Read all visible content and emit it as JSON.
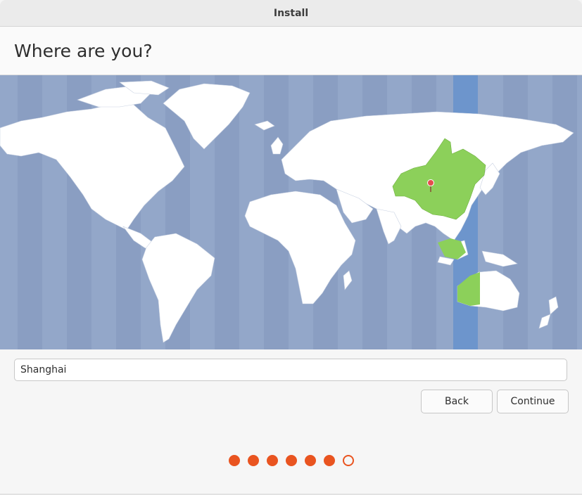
{
  "window": {
    "title": "Install"
  },
  "page": {
    "title": "Where are you?"
  },
  "map": {
    "selected_region": "China / Asia/Shanghai",
    "colors": {
      "ocean": "#93a7c9",
      "land": "#ffffff",
      "selected_land": "#8cd05a",
      "timezone_highlight": "#6d95cc",
      "pin": "#e44d4d"
    }
  },
  "location": {
    "value": "Shanghai"
  },
  "buttons": {
    "back": "Back",
    "continue": "Continue"
  },
  "progress": {
    "total_steps": 7,
    "completed_steps": 6,
    "accent": "#e95420"
  }
}
